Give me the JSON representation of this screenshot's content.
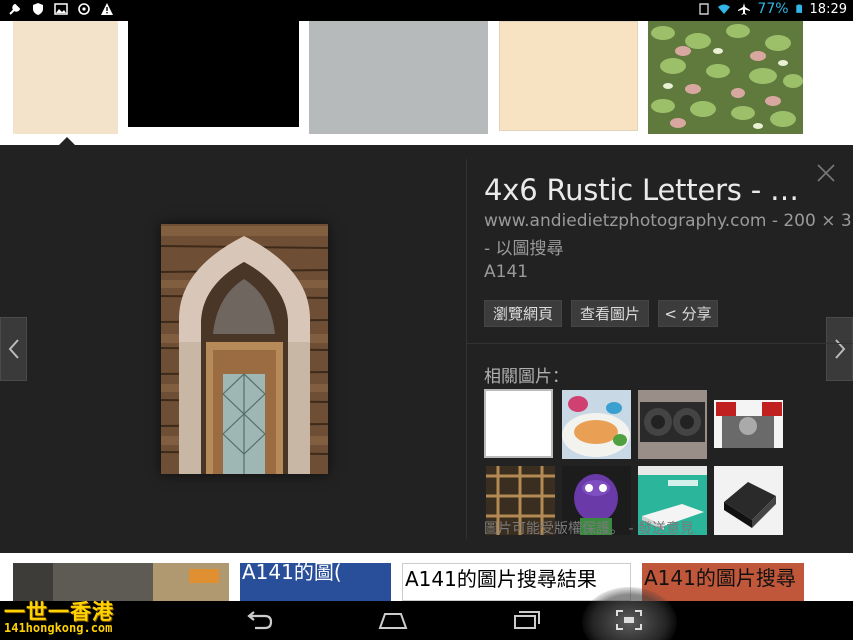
{
  "status_bar": {
    "battery_percent": "77%",
    "time": "18:29"
  },
  "preview": {
    "title": "4x6 Rustic Letters - …",
    "url_line": "www.andiedietzphotography.com - 200 × 3",
    "search_by_image": " - 以圖搜尋",
    "description": "A141",
    "buttons": {
      "visit": "瀏覽網頁",
      "view": "查看圖片",
      "share": "< 分享"
    },
    "related_label": "相關圖片：",
    "copyright_notice": "圖片可能受版權保護。",
    "feedback_link": " - 發送意見"
  },
  "bottom_results": {
    "item2": "A141的圖(",
    "item3": "A141的圖片搜尋結果",
    "item4": "A141的圖片搜尋"
  },
  "watermark": {
    "name": "一世一香港",
    "site": "141hongkong.com"
  },
  "colors": {
    "panel_bg": "#222222",
    "accent_blue": "#33b5e5",
    "watermark_yellow": "#ffd200"
  }
}
